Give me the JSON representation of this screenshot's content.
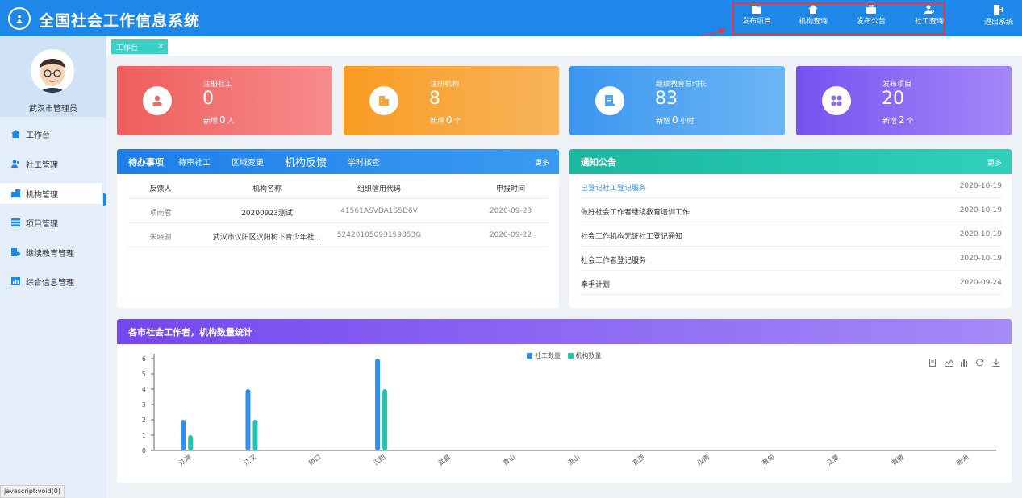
{
  "app": {
    "title": "全国社会工作信息系统",
    "logo_char": "⓪"
  },
  "top_nav": {
    "items": [
      {
        "label": "发布项目",
        "icon": "folder-icon"
      },
      {
        "label": "机构查询",
        "icon": "home-icon"
      },
      {
        "label": "发布公告",
        "icon": "briefcase-icon"
      },
      {
        "label": "社工查询",
        "icon": "user-search-icon"
      }
    ],
    "logout_label": "退出系统"
  },
  "user": {
    "name": "武汉市管理员"
  },
  "sidebar": {
    "items": [
      {
        "label": "工作台",
        "icon": "home-icon"
      },
      {
        "label": "社工管理",
        "icon": "users-icon"
      },
      {
        "label": "机构管理",
        "icon": "building-icon"
      },
      {
        "label": "项目管理",
        "icon": "list-icon"
      },
      {
        "label": "继续教育管理",
        "icon": "book-icon"
      },
      {
        "label": "综合信息管理",
        "icon": "chart-icon"
      }
    ]
  },
  "tab": {
    "label": "工作台",
    "close": "×"
  },
  "cards": [
    {
      "label": "注册社工",
      "value": "0",
      "sub_prefix": "新增",
      "sub_value": "0",
      "sub_unit": "人",
      "color": "#f26b6b"
    },
    {
      "label": "注册机构",
      "value": "8",
      "sub_prefix": "新增",
      "sub_value": "0",
      "sub_unit": "个",
      "color": "#f9a33a"
    },
    {
      "label": "继续教育总时长",
      "value": "83",
      "sub_prefix": "新增",
      "sub_value": "0",
      "sub_unit": "小时",
      "color": "#4ea3f1"
    },
    {
      "label": "发布项目",
      "value": "20",
      "sub_prefix": "新增",
      "sub_value": "2",
      "sub_unit": "个",
      "color": "#8b6cf6"
    }
  ],
  "todo": {
    "title": "待办事项",
    "tabs": [
      "待审社工",
      "区域变更",
      "机构反馈",
      "学时核查"
    ],
    "more": "更多",
    "headers": [
      "反馈人",
      "机构名称",
      "组织信用代码",
      "申报时间"
    ],
    "rows": [
      [
        "项雨君",
        "20200923测试",
        "41561ASVDA1S5D6V",
        "2020-09-23"
      ],
      [
        "朱晓骢",
        "武汉市汉阳区汉阳树下青少年社...",
        "52420105093159853G",
        "2020-09-22"
      ]
    ]
  },
  "notice": {
    "title": "通知公告",
    "more": "更多",
    "rows": [
      {
        "title": "已登记社工登记服务",
        "date": "2020-10-19"
      },
      {
        "title": "做好社会工作者继续教育培训工作",
        "date": "2020-10-19"
      },
      {
        "title": "社会工作机构无证社工登记通知",
        "date": "2020-10-19"
      },
      {
        "title": "社会工作者登记服务",
        "date": "2020-10-19"
      },
      {
        "title": "牵手计划",
        "date": "2020-09-24"
      }
    ]
  },
  "stats_panel": {
    "title": "各市社会工作者，机构数量统计"
  },
  "chart_data": {
    "type": "bar",
    "categories": [
      "江岸",
      "江汉",
      "硚口",
      "汉阳",
      "武昌",
      "青山",
      "洪山",
      "东西",
      "汉南",
      "蔡甸",
      "江夏",
      "黄陂",
      "新洲"
    ],
    "series": [
      {
        "name": "社工数量",
        "values": [
          2,
          4,
          0,
          6,
          0,
          0,
          0,
          0,
          0,
          0,
          0,
          0,
          0
        ],
        "color": "#2f8ff0"
      },
      {
        "name": "机构数量",
        "values": [
          1,
          2,
          0,
          4,
          0,
          0,
          0,
          0,
          0,
          0,
          0,
          0,
          0
        ],
        "color": "#22c3a7"
      }
    ],
    "ylim": [
      0,
      6
    ],
    "yticks": [
      0,
      1,
      2,
      3,
      4,
      5,
      6
    ],
    "legend": "top-center",
    "grid": false
  },
  "statusbar": {
    "text": "javascript:void(0)"
  }
}
